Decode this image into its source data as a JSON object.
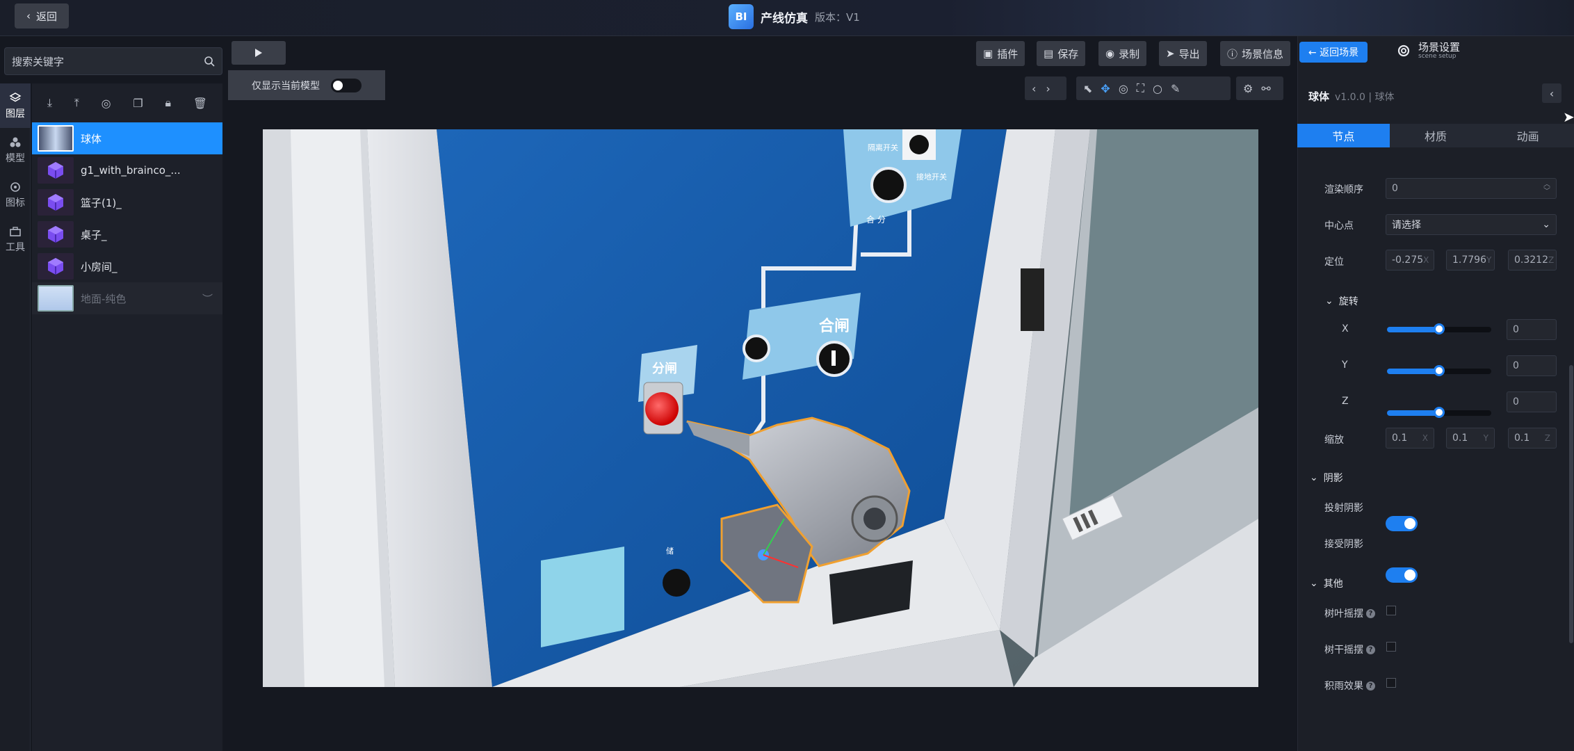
{
  "topbar": {
    "back_label": "返回",
    "logo_text": "BI",
    "title": "产线仿真",
    "version": "版本：V1"
  },
  "search": {
    "placeholder": "搜索关键字"
  },
  "rail": [
    {
      "label": "图层",
      "icon": "layers-icon"
    },
    {
      "label": "模型",
      "icon": "model-icon"
    },
    {
      "label": "图标",
      "icon": "location-icon"
    },
    {
      "label": "工具",
      "icon": "toolbox-icon"
    }
  ],
  "layers": [
    {
      "name": "球体",
      "type": "sphere",
      "selected": true
    },
    {
      "name": "g1_with_brainco_...",
      "type": "model"
    },
    {
      "name": "篮子(1)_",
      "type": "model"
    },
    {
      "name": "桌子_",
      "type": "model"
    },
    {
      "name": "小房间_",
      "type": "model"
    },
    {
      "name": "地面-纯色",
      "type": "ground",
      "hidden": true
    }
  ],
  "toolbar": {
    "plugin": "插件",
    "save": "保存",
    "record": "录制",
    "export": "导出",
    "scene_info": "场景信息"
  },
  "only_show": {
    "label": "仅显示当前模型",
    "enabled": false
  },
  "right_panel": {
    "back_scene": "← 返回场景",
    "scene_setup": "场景设置",
    "scene_setup_sub": "scene setup",
    "object_name": "球体",
    "object_meta": "v1.0.0 | 球体",
    "tabs": [
      "节点",
      "材质",
      "动画"
    ],
    "render_order_label": "渲染顺序",
    "render_order_value": "0",
    "center_label": "中心点",
    "center_placeholder": "请选择",
    "position_label": "定位",
    "position": [
      "-0.275",
      "1.7796",
      "0.3212"
    ],
    "position_axes": [
      "X",
      "Y",
      "Z"
    ],
    "rotation_label": "旋转",
    "rotation": [
      {
        "axis": "X",
        "value": "0",
        "level": 0.5
      },
      {
        "axis": "Y",
        "value": "0",
        "level": 0.5
      },
      {
        "axis": "Z",
        "value": "0",
        "level": 0.5
      }
    ],
    "scale_label": "缩放",
    "scale": [
      "0.1",
      "0.1",
      "0.1"
    ],
    "shadow_label": "阴影",
    "cast_shadow_label": "投射阴影",
    "cast_shadow": true,
    "receive_shadow_label": "接受阴影",
    "receive_shadow": true,
    "other_label": "其他",
    "leaf_sway_label": "树叶摇摆",
    "trunk_sway_label": "树干摇摆",
    "rain_effect_label": "积雨效果"
  },
  "viewport": {
    "panel_labels": {
      "close": "合闸",
      "open": "分闸",
      "sw1": "隔离开关",
      "sw2": "接地开关",
      "combine": "合 分",
      "roll": "储"
    }
  },
  "colors": {
    "accent": "#1e7ff0",
    "panel_blue": "#1859a8",
    "button_red": "#e01818",
    "outline": "#f0a030"
  }
}
